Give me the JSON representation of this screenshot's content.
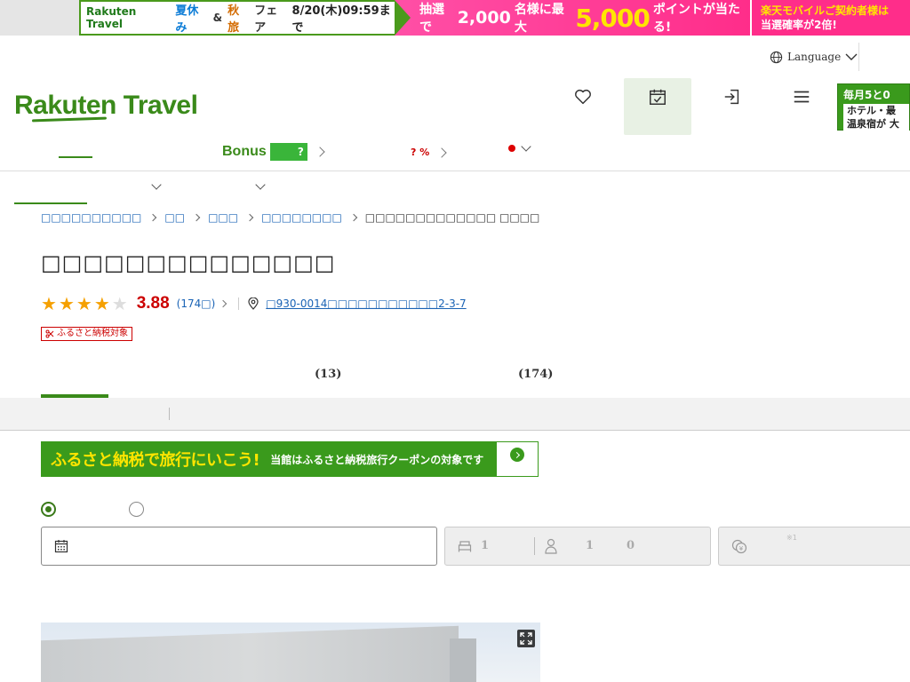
{
  "promo": {
    "brand": "Rakuten Travel",
    "summer": "夏休み",
    "and": "&",
    "autumn": "秋旅",
    "fair": "フェア",
    "date": "8/20(木)09:59まで",
    "lottery_prefix": "抽選で",
    "lottery_count": "2,000",
    "lottery_mid": "名様に最大",
    "points": "5,000",
    "points_unit": "ポイントが当たる!",
    "mobile_line1": "楽天モバイルご契約者様は",
    "mobile_line2": "当選確率が2倍!"
  },
  "language": {
    "label": "Language"
  },
  "header": {
    "logo": "Rakuten Travel",
    "side_promo_line1": "毎月5と0",
    "side_promo_line2": "ホテル・最",
    "side_promo_line3": "温泉宿が 大"
  },
  "nav": {
    "bonus_label": "Bonus",
    "bonus_box": "?",
    "percent_label": "? %"
  },
  "breadcrumb": [
    {
      "label": "□□□□□□□□□□"
    },
    {
      "label": "□□"
    },
    {
      "label": "□□□"
    },
    {
      "label": "□□□□□□□□"
    },
    {
      "label": "□□□□□□□□□□□□□ □□□□"
    }
  ],
  "hotel": {
    "name": "□□□□□□□□□□□□□□",
    "rating": 4,
    "rating_max": 5,
    "score": "3.88",
    "review_count": "(174□)",
    "address": "□930-0014□□□□□□□□□□□2-3-7",
    "furusato_badge": "ふるさと納税対象"
  },
  "page_tabs": [
    {
      "label": "(13)"
    },
    {
      "label": "(174)"
    }
  ],
  "furusato_banner": {
    "title": "ふるさと納税で旅行にいこう!",
    "subtitle": "当館はふるさと納税旅行クーポンの対象です"
  },
  "search": {
    "rooms": "1",
    "adults": "1",
    "children": "0",
    "price_note": "※1"
  }
}
